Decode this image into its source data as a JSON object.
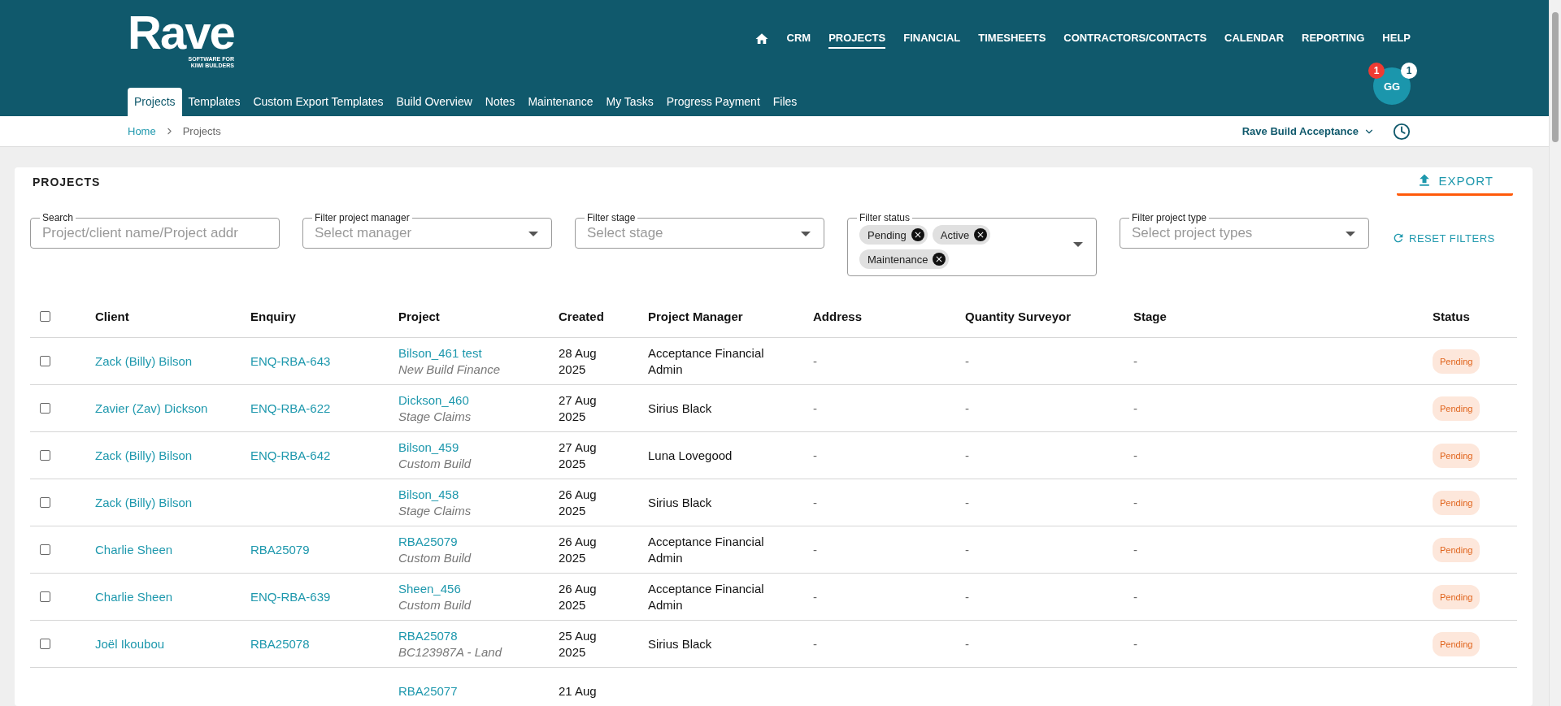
{
  "brand": {
    "name": "Rave",
    "tagline": [
      "SOFTWARE FOR",
      "KIWI BUILDERS"
    ]
  },
  "top_nav": [
    {
      "label": "CRM",
      "selected": false
    },
    {
      "label": "PROJECTS",
      "selected": true
    },
    {
      "label": "FINANCIAL",
      "selected": false
    },
    {
      "label": "TIMESHEETS",
      "selected": false
    },
    {
      "label": "CONTRACTORS/CONTACTS",
      "selected": false
    },
    {
      "label": "CALENDAR",
      "selected": false
    },
    {
      "label": "REPORTING",
      "selected": false
    },
    {
      "label": "HELP",
      "selected": false
    }
  ],
  "user": {
    "initials": "GG",
    "alert_count": "1",
    "notification_count": "1"
  },
  "tabs": [
    {
      "label": "Projects",
      "selected": true
    },
    {
      "label": "Templates",
      "selected": false
    },
    {
      "label": "Custom Export Templates",
      "selected": false
    },
    {
      "label": "Build Overview",
      "selected": false
    },
    {
      "label": "Notes",
      "selected": false
    },
    {
      "label": "Maintenance",
      "selected": false
    },
    {
      "label": "My Tasks",
      "selected": false
    },
    {
      "label": "Progress Payment",
      "selected": false
    },
    {
      "label": "Files",
      "selected": false
    }
  ],
  "breadcrumb": [
    "Home",
    "Projects"
  ],
  "workspace": "Rave Build Acceptance",
  "panel": {
    "title": "PROJECTS",
    "export": "EXPORT",
    "reset": "RESET FILTERS"
  },
  "filters": [
    {
      "kind": "text",
      "label": "Search",
      "placeholder": "Project/client name/Project addr"
    },
    {
      "kind": "select",
      "label": "Filter project manager",
      "placeholder": "Select manager"
    },
    {
      "kind": "select",
      "label": "Filter stage",
      "placeholder": "Select stage"
    },
    {
      "kind": "chips",
      "label": "Filter status",
      "chips": [
        "Pending",
        "Active",
        "Maintenance"
      ]
    },
    {
      "kind": "select",
      "label": "Filter project type",
      "placeholder": "Select project types"
    }
  ],
  "table": {
    "select_all": {
      "checked": false
    },
    "columns": [
      "Client",
      "Enquiry",
      "Project",
      "Created",
      "Project Manager",
      "Address",
      "Quantity Surveyor",
      "Stage",
      "Status"
    ],
    "rows": [
      {
        "checked": false,
        "client": "Zack (Billy) Bilson",
        "enquiry": "ENQ-RBA-643",
        "project": "Bilson_461 test",
        "project_type": "New Build Finance",
        "created": "28 Aug 2025",
        "manager": "Acceptance Financial Admin",
        "address": "-",
        "surveyor": "-",
        "stage": "-",
        "status": "Pending"
      },
      {
        "checked": false,
        "client": "Zavier (Zav) Dickson",
        "enquiry": "ENQ-RBA-622",
        "project": "Dickson_460",
        "project_type": "Stage Claims",
        "created": "27 Aug 2025",
        "manager": "Sirius Black",
        "address": "-",
        "surveyor": "-",
        "stage": "-",
        "status": "Pending"
      },
      {
        "checked": false,
        "client": "Zack (Billy) Bilson",
        "enquiry": "ENQ-RBA-642",
        "project": "Bilson_459",
        "project_type": "Custom Build",
        "created": "27 Aug 2025",
        "manager": "Luna Lovegood",
        "address": "-",
        "surveyor": "-",
        "stage": "-",
        "status": "Pending"
      },
      {
        "checked": false,
        "client": "Zack (Billy) Bilson",
        "project": "Bilson_458",
        "project_type": "Stage Claims",
        "created": "26 Aug 2025",
        "manager": "Sirius Black",
        "address": "-",
        "surveyor": "-",
        "stage": "-",
        "status": "Pending"
      },
      {
        "checked": false,
        "client": "Charlie Sheen",
        "enquiry": "RBA25079",
        "project": "RBA25079",
        "project_type": "Custom Build",
        "created": "26 Aug 2025",
        "manager": "Acceptance Financial Admin",
        "address": "-",
        "surveyor": "-",
        "stage": "-",
        "status": "Pending"
      },
      {
        "checked": false,
        "client": "Charlie Sheen",
        "enquiry": "ENQ-RBA-639",
        "project": "Sheen_456",
        "project_type": "Custom Build",
        "created": "26 Aug 2025",
        "manager": "Acceptance Financial Admin",
        "address": "-",
        "surveyor": "-",
        "stage": "-",
        "status": "Pending"
      },
      {
        "checked": false,
        "client": "Joël Ikoubou",
        "enquiry": "RBA25078",
        "project": "RBA25078",
        "project_type": "BC123987A - Land",
        "created": "25 Aug 2025",
        "manager": "Sirius Black",
        "address": "-",
        "surveyor": "-",
        "stage": "-",
        "status": "Pending"
      },
      {
        "project": "RBA25077",
        "created": "21 Aug"
      }
    ]
  }
}
